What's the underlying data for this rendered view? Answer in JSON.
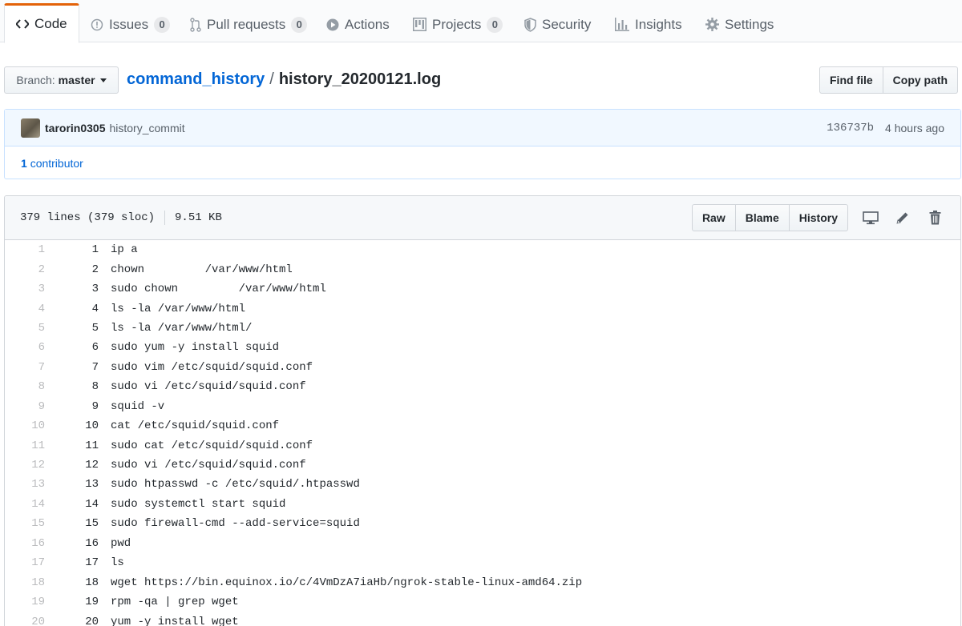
{
  "tabs": [
    {
      "label": "Code",
      "icon": "code-icon",
      "selected": true
    },
    {
      "label": "Issues",
      "icon": "issue-opened-icon",
      "count": "0"
    },
    {
      "label": "Pull requests",
      "icon": "git-pull-request-icon",
      "count": "0"
    },
    {
      "label": "Actions",
      "icon": "play-icon"
    },
    {
      "label": "Projects",
      "icon": "project-icon",
      "count": "0"
    },
    {
      "label": "Security",
      "icon": "shield-icon"
    },
    {
      "label": "Insights",
      "icon": "graph-icon"
    },
    {
      "label": "Settings",
      "icon": "gear-icon"
    }
  ],
  "branch": {
    "label": "Branch:",
    "value": "master"
  },
  "breadcrumb": {
    "repo": "command_history",
    "separator": "/",
    "file": "history_20200121.log"
  },
  "file_buttons": {
    "find": "Find file",
    "copy": "Copy path"
  },
  "commit": {
    "author": "tarorin0305",
    "message": "history_commit",
    "sha": "136737b",
    "time": "4 hours ago",
    "contributors_count": "1",
    "contributors_label": "contributor"
  },
  "file_info": {
    "lines": "379 lines (379 sloc)",
    "size": "9.51 KB"
  },
  "view_buttons": {
    "raw": "Raw",
    "blame": "Blame",
    "history": "History"
  },
  "lines": [
    {
      "n": "1",
      "hn": "1",
      "cmd": "ip a"
    },
    {
      "n": "2",
      "hn": "2",
      "cmd": "chown         /var/www/html"
    },
    {
      "n": "3",
      "hn": "3",
      "cmd": "sudo chown         /var/www/html"
    },
    {
      "n": "4",
      "hn": "4",
      "cmd": "ls -la /var/www/html"
    },
    {
      "n": "5",
      "hn": "5",
      "cmd": "ls -la /var/www/html/"
    },
    {
      "n": "6",
      "hn": "6",
      "cmd": "sudo yum -y install squid"
    },
    {
      "n": "7",
      "hn": "7",
      "cmd": "sudo vim /etc/squid/squid.conf"
    },
    {
      "n": "8",
      "hn": "8",
      "cmd": "sudo vi /etc/squid/squid.conf"
    },
    {
      "n": "9",
      "hn": "9",
      "cmd": "squid -v"
    },
    {
      "n": "10",
      "hn": "10",
      "cmd": "cat /etc/squid/squid.conf"
    },
    {
      "n": "11",
      "hn": "11",
      "cmd": "sudo cat /etc/squid/squid.conf"
    },
    {
      "n": "12",
      "hn": "12",
      "cmd": "sudo vi /etc/squid/squid.conf"
    },
    {
      "n": "13",
      "hn": "13",
      "cmd": "sudo htpasswd -c /etc/squid/.htpasswd"
    },
    {
      "n": "14",
      "hn": "14",
      "cmd": "sudo systemctl start squid"
    },
    {
      "n": "15",
      "hn": "15",
      "cmd": "sudo firewall-cmd --add-service=squid"
    },
    {
      "n": "16",
      "hn": "16",
      "cmd": "pwd"
    },
    {
      "n": "17",
      "hn": "17",
      "cmd": "ls"
    },
    {
      "n": "18",
      "hn": "18",
      "cmd": "wget https://bin.equinox.io/c/4VmDzA7iaHb/ngrok-stable-linux-amd64.zip"
    },
    {
      "n": "19",
      "hn": "19",
      "cmd": "rpm -qa | grep wget"
    },
    {
      "n": "20",
      "hn": "20",
      "cmd": "yum -y install wget"
    }
  ]
}
